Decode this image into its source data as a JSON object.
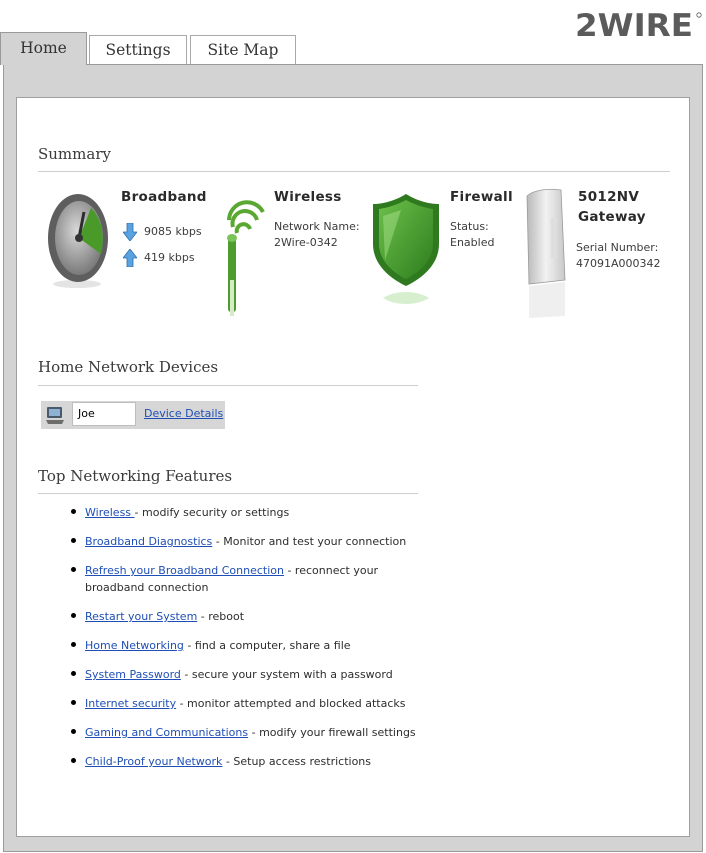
{
  "brand": {
    "logo_text": "2WIRE"
  },
  "tabs": [
    {
      "label": "Home",
      "active": true
    },
    {
      "label": "Settings",
      "active": false
    },
    {
      "label": "Site Map",
      "active": false
    }
  ],
  "summary": {
    "heading": "Summary",
    "broadband": {
      "title": "Broadband",
      "down_rate": "9085 kbps",
      "up_rate": "419 kbps"
    },
    "wireless": {
      "title": "Wireless",
      "network_name_label": "Network Name:",
      "network_name": "2Wire-0342"
    },
    "firewall": {
      "title": "Firewall",
      "status_label": "Status:",
      "status": "Enabled"
    },
    "gateway": {
      "title_line1": "5012NV",
      "title_line2": "Gateway",
      "serial_label": "Serial Number:",
      "serial": "47091A000342"
    }
  },
  "home_network": {
    "heading": "Home Network Devices",
    "devices": [
      {
        "name": "Joe",
        "details_label": "Device Details"
      }
    ]
  },
  "features": {
    "heading": "Top Networking Features",
    "items": [
      {
        "link": "Wireless ",
        "desc": " - modify security or settings"
      },
      {
        "link": "Broadband Diagnostics",
        "desc": " - Monitor and test your connection"
      },
      {
        "link": "Refresh your Broadband Connection",
        "desc": " - reconnect your broadband connection"
      },
      {
        "link": "Restart your System",
        "desc": " - reboot"
      },
      {
        "link": "Home Networking",
        "desc": " - find a computer, share a file"
      },
      {
        "link": "System Password",
        "desc": " - secure your system with a password"
      },
      {
        "link": "Internet security",
        "desc": " - monitor attempted and blocked attacks"
      },
      {
        "link": "Gaming and Communications",
        "desc": " - modify your firewall settings"
      },
      {
        "link": "Child-Proof your Network",
        "desc": " - Setup access restrictions"
      }
    ]
  },
  "colors": {
    "link": "#1f4fb5",
    "frame": "#d3d3d3",
    "gauge_green": "#4a9a2a",
    "firewall_green": "#3f9a2e",
    "arrow_blue": "#3d8fd6"
  }
}
